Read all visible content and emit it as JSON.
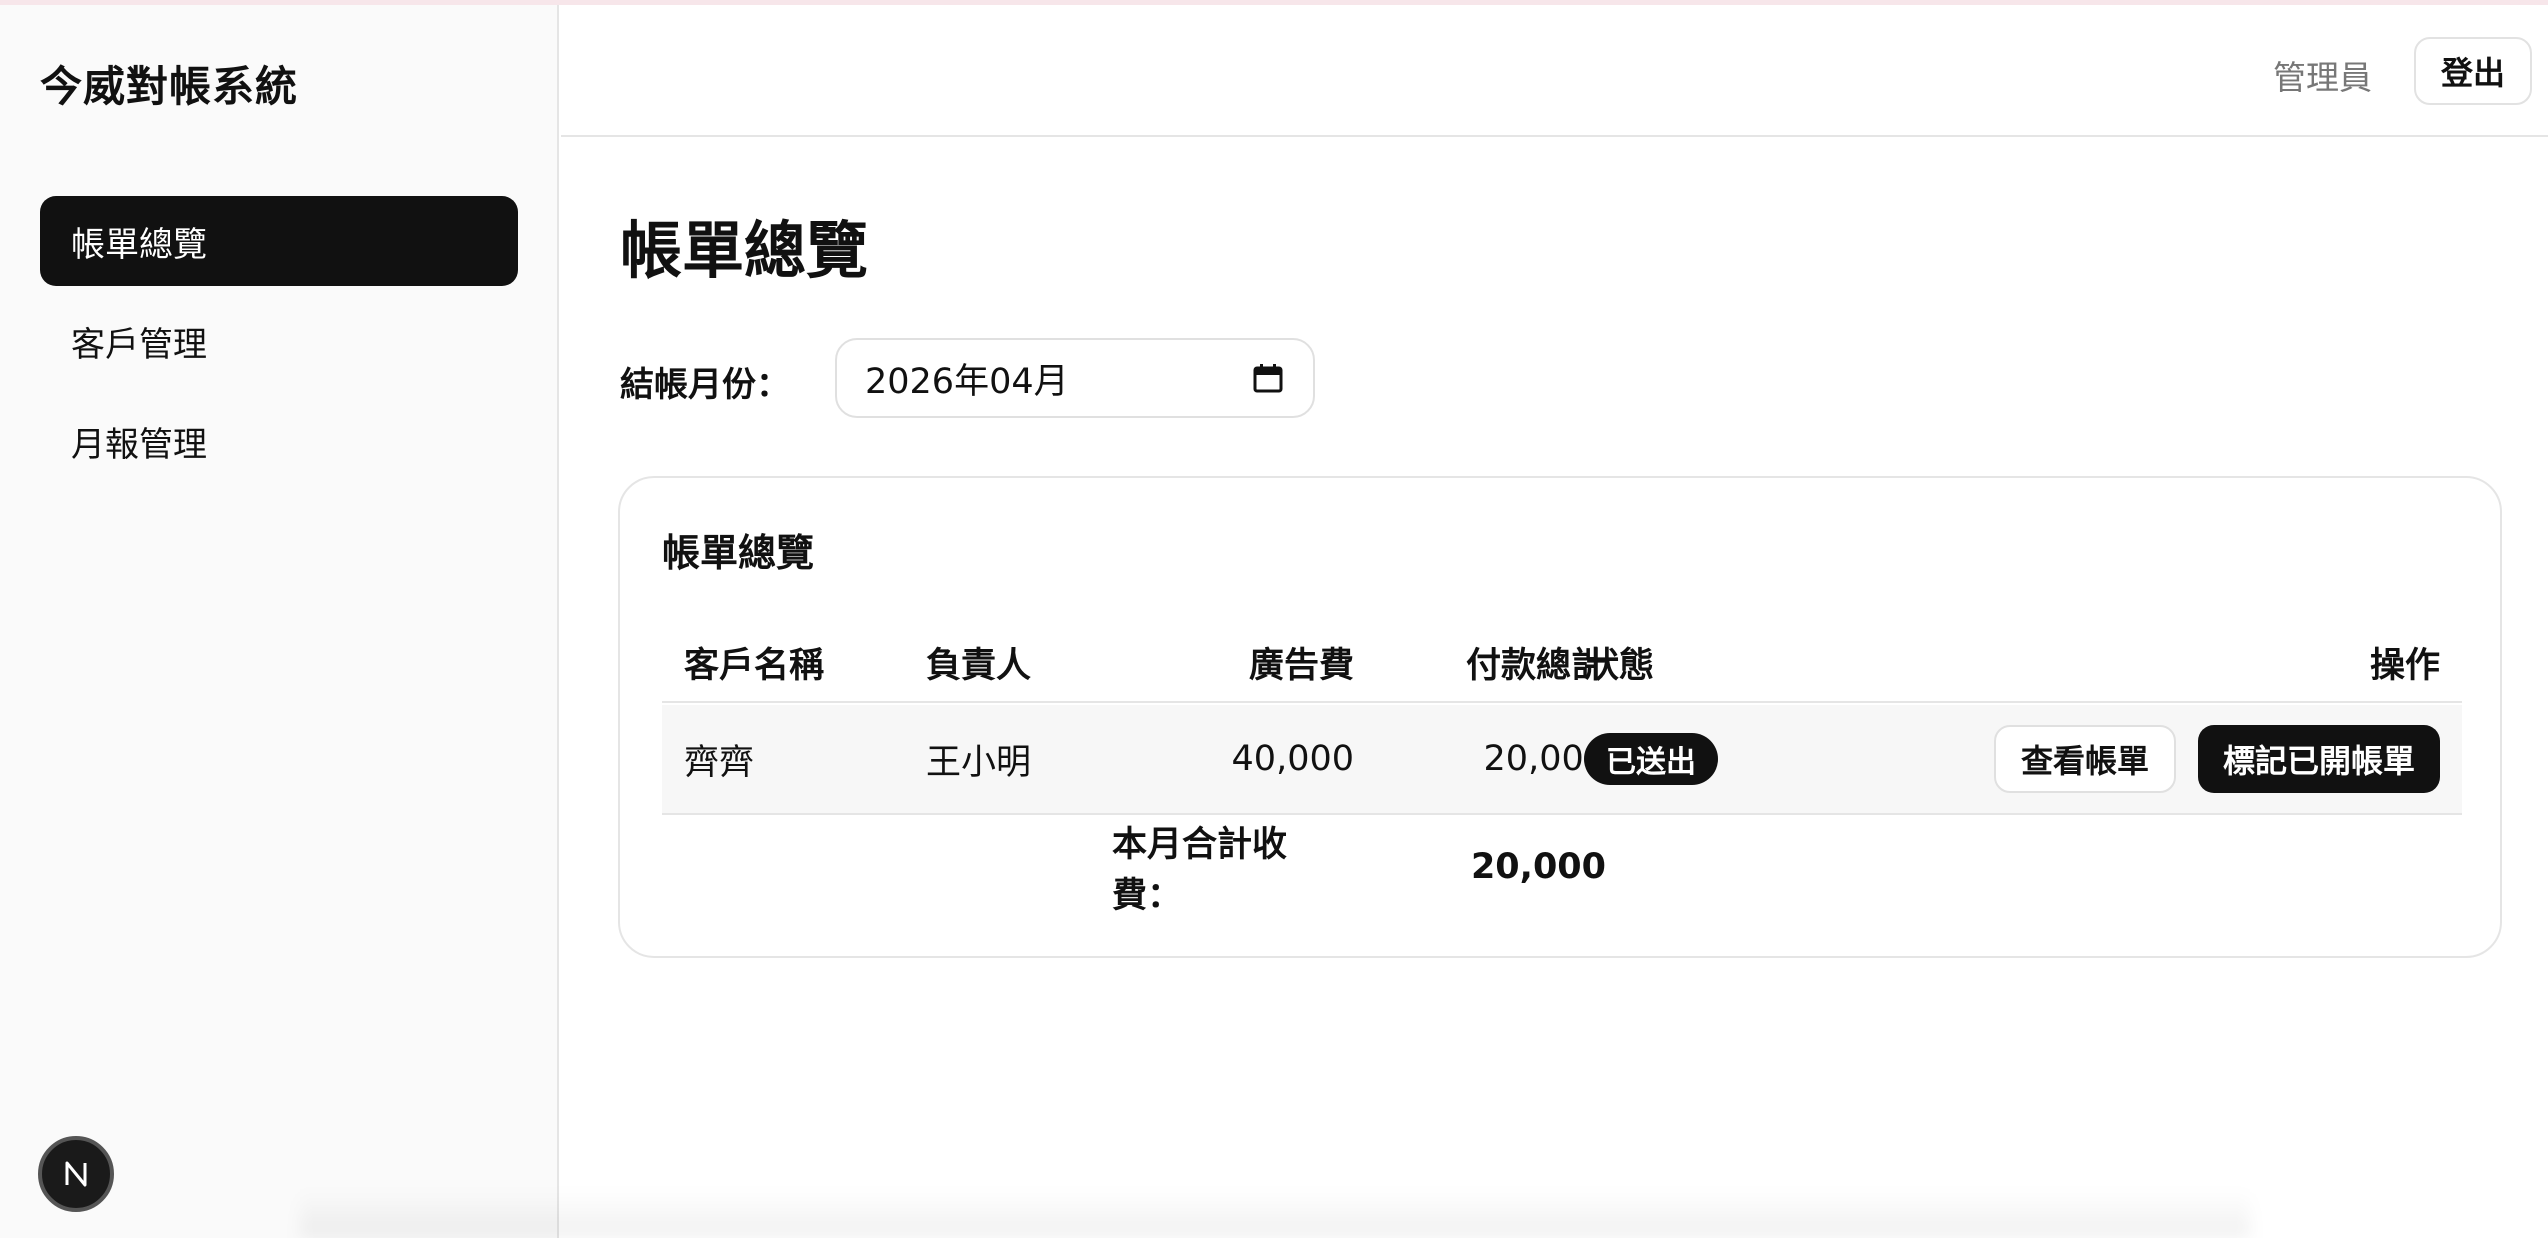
{
  "app": {
    "title": "今威對帳系統"
  },
  "sidebar": {
    "items": [
      {
        "label": "帳單總覽",
        "active": true
      },
      {
        "label": "客戶管理",
        "active": false
      },
      {
        "label": "月報管理",
        "active": false
      }
    ],
    "badge_letter": "N"
  },
  "header": {
    "user_role": "管理員",
    "logout_label": "登出"
  },
  "main": {
    "page_title": "帳單總覽",
    "month_filter": {
      "label": "結帳月份：",
      "value": "2026年04月",
      "icon": "calendar-icon"
    },
    "card": {
      "title": "帳單總覽",
      "columns": [
        "客戶名稱",
        "負責人",
        "廣告費",
        "付款總計",
        "狀態",
        "操作"
      ],
      "rows": [
        {
          "client": "齊齊",
          "owner": "王小明",
          "ad_fee": "40,000",
          "payment_total": "20,000",
          "status": "已送出",
          "actions": {
            "view": "查看帳單",
            "mark": "標記已開帳單"
          }
        }
      ],
      "footer": {
        "label": "本月合計收費：",
        "total": "20,000"
      }
    }
  },
  "colors": {
    "primary": "#111111",
    "border": "#e5e5e5",
    "sidebar_bg": "#fafafa",
    "muted_text": "#777777"
  }
}
